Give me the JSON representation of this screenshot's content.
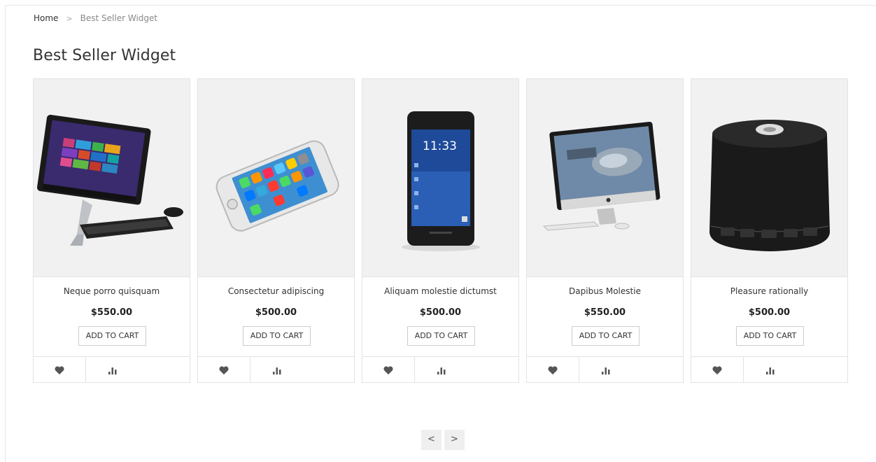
{
  "breadcrumb": {
    "home": "Home",
    "separator": ">",
    "current": "Best Seller Widget"
  },
  "page_title": "Best Seller Widget",
  "products": [
    {
      "name": "Neque porro quisquam",
      "price": "$550.00",
      "button": "ADD TO CART",
      "image": "all-in-one-desktop"
    },
    {
      "name": "Consectetur adipiscing",
      "price": "$500.00",
      "button": "ADD TO CART",
      "image": "smartphone"
    },
    {
      "name": "Aliquam molestie dictumst",
      "price": "$500.00",
      "button": "ADD TO CART",
      "image": "blackberry-phone",
      "screen_time": "11:33"
    },
    {
      "name": "Dapibus Molestie",
      "price": "$550.00",
      "button": "ADD TO CART",
      "image": "imac-desktop"
    },
    {
      "name": "Pleasure rationally",
      "price": "$500.00",
      "button": "ADD TO CART",
      "image": "bluetooth-speaker"
    }
  ],
  "pager": {
    "prev": "<",
    "next": ">"
  },
  "icons": {
    "wishlist": "heart-icon",
    "compare": "bar-chart-icon"
  },
  "colors": {
    "image_bg": "#f1f1f1",
    "border": "#e3e3e3",
    "icon": "#555555",
    "pager_bg": "#efefef"
  }
}
